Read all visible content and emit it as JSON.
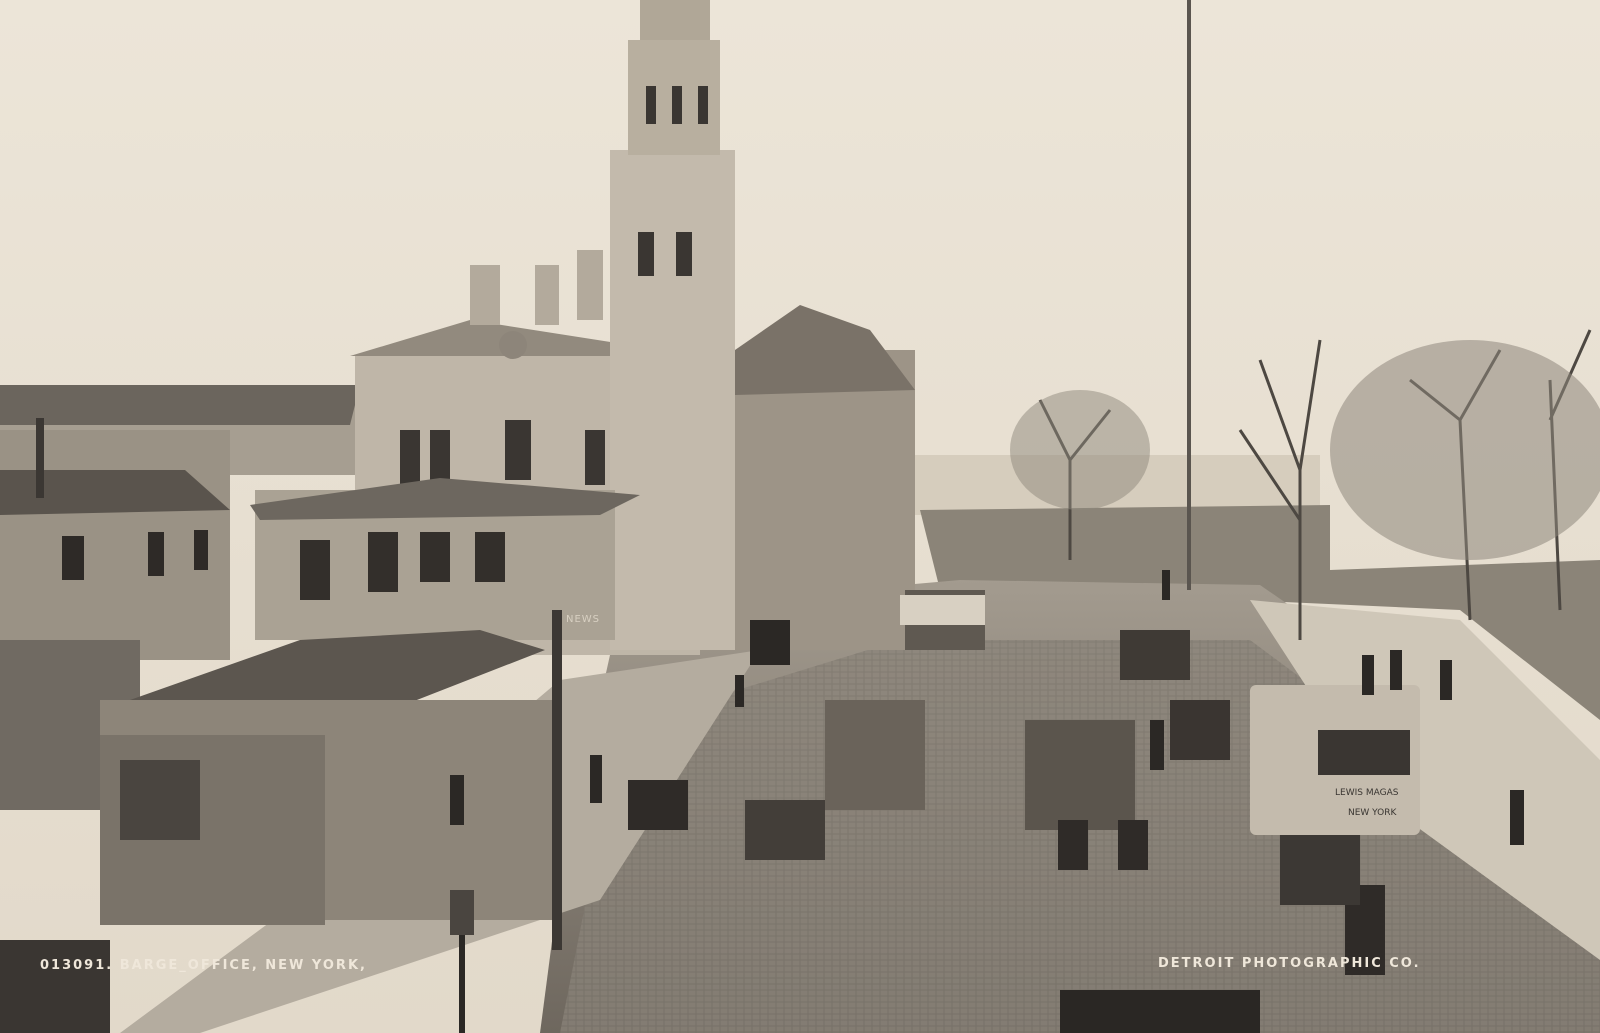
{
  "photo": {
    "caption_left": "013091. BARGE_OFFICE, NEW YORK,",
    "caption_right": "DETROIT PHOTOGRAPHIC CO.",
    "news_sign": "NEWS",
    "wagon_sign_top": "LEWIS MAGAS",
    "wagon_sign_bottom": "NEW YORK"
  },
  "colors": {
    "sky": "#e9e1d3",
    "stone": "#b9b0a2",
    "dark_roof": "#4a4540",
    "street": "#8c857b",
    "shadow": "#2a2724"
  }
}
